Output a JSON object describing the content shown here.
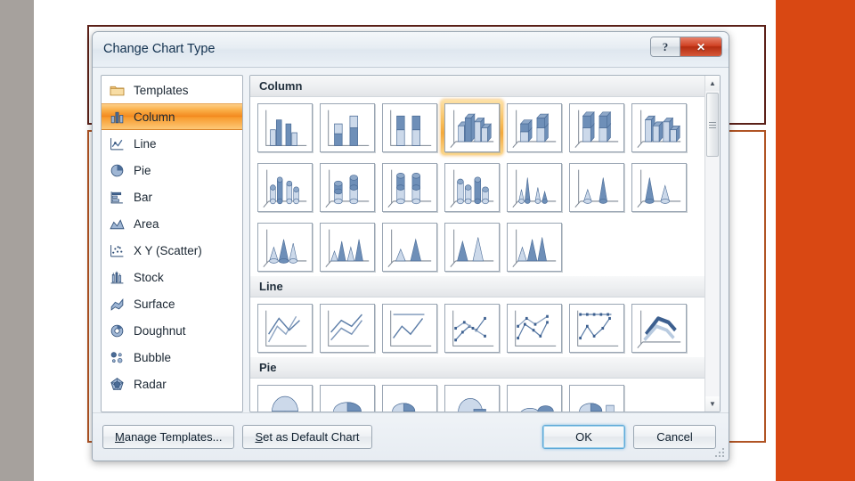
{
  "slide": {
    "left_bar_color": "#a6a19d",
    "right_bar_color": "#d94813",
    "placeholder_top_border": "#5b2018",
    "placeholder_bottom_border": "#b05424"
  },
  "dialog": {
    "title": "Change Chart Type",
    "help_button": "?",
    "close_button": "✕",
    "accent_selected": "#f2881d",
    "default_button_focus": "#5fa9d8"
  },
  "sidebar": {
    "items": [
      {
        "label": "Templates",
        "icon": "folder-icon",
        "selected": false
      },
      {
        "label": "Column",
        "icon": "column-chart-icon",
        "selected": true
      },
      {
        "label": "Line",
        "icon": "line-chart-icon",
        "selected": false
      },
      {
        "label": "Pie",
        "icon": "pie-chart-icon",
        "selected": false
      },
      {
        "label": "Bar",
        "icon": "bar-chart-icon",
        "selected": false
      },
      {
        "label": "Area",
        "icon": "area-chart-icon",
        "selected": false
      },
      {
        "label": "X Y (Scatter)",
        "icon": "scatter-chart-icon",
        "selected": false
      },
      {
        "label": "Stock",
        "icon": "stock-chart-icon",
        "selected": false
      },
      {
        "label": "Surface",
        "icon": "surface-chart-icon",
        "selected": false
      },
      {
        "label": "Doughnut",
        "icon": "doughnut-chart-icon",
        "selected": false
      },
      {
        "label": "Bubble",
        "icon": "bubble-chart-icon",
        "selected": false
      },
      {
        "label": "Radar",
        "icon": "radar-chart-icon",
        "selected": false
      }
    ]
  },
  "gallery": {
    "sections": [
      {
        "title": "Column",
        "rows": [
          [
            {
              "name": "clustered-column",
              "selected": false
            },
            {
              "name": "stacked-column",
              "selected": false
            },
            {
              "name": "100-percent-stacked-column",
              "selected": false
            },
            {
              "name": "3d-clustered-column",
              "selected": true
            },
            {
              "name": "stacked-column-in-3d",
              "selected": false
            },
            {
              "name": "100-percent-stacked-column-in-3d",
              "selected": false
            },
            {
              "name": "3d-column",
              "selected": false
            }
          ],
          [
            {
              "name": "clustered-cylinder",
              "selected": false
            },
            {
              "name": "stacked-cylinder",
              "selected": false
            },
            {
              "name": "100-percent-stacked-cylinder",
              "selected": false
            },
            {
              "name": "3d-cylinder",
              "selected": false
            },
            {
              "name": "clustered-cone",
              "selected": false
            },
            {
              "name": "stacked-cone",
              "selected": false
            },
            {
              "name": "100-percent-stacked-cone",
              "selected": false
            }
          ],
          [
            {
              "name": "3d-cone",
              "selected": false
            },
            {
              "name": "clustered-pyramid",
              "selected": false
            },
            {
              "name": "stacked-pyramid",
              "selected": false
            },
            {
              "name": "100-percent-stacked-pyramid",
              "selected": false
            },
            {
              "name": "3d-pyramid",
              "selected": false
            }
          ]
        ]
      },
      {
        "title": "Line",
        "rows": [
          [
            {
              "name": "line",
              "selected": false
            },
            {
              "name": "stacked-line",
              "selected": false
            },
            {
              "name": "100-percent-stacked-line",
              "selected": false
            },
            {
              "name": "line-with-markers",
              "selected": false
            },
            {
              "name": "stacked-line-with-markers",
              "selected": false
            },
            {
              "name": "100-percent-stacked-line-with-markers",
              "selected": false
            },
            {
              "name": "3d-line",
              "selected": false
            }
          ]
        ]
      },
      {
        "title": "Pie",
        "rows": [
          [
            {
              "name": "pie",
              "selected": false
            },
            {
              "name": "pie-in-3d",
              "selected": false
            },
            {
              "name": "pie-of-pie",
              "selected": false
            },
            {
              "name": "exploded-pie",
              "selected": false
            },
            {
              "name": "exploded-pie-in-3d",
              "selected": false
            },
            {
              "name": "bar-of-pie",
              "selected": false
            }
          ]
        ]
      }
    ]
  },
  "scrollbar": {
    "up_arrow": "▲",
    "down_arrow": "▼"
  },
  "footer": {
    "manage_templates": "Manage Templates...",
    "set_default": "Set as Default Chart",
    "ok": "OK",
    "cancel": "Cancel"
  }
}
